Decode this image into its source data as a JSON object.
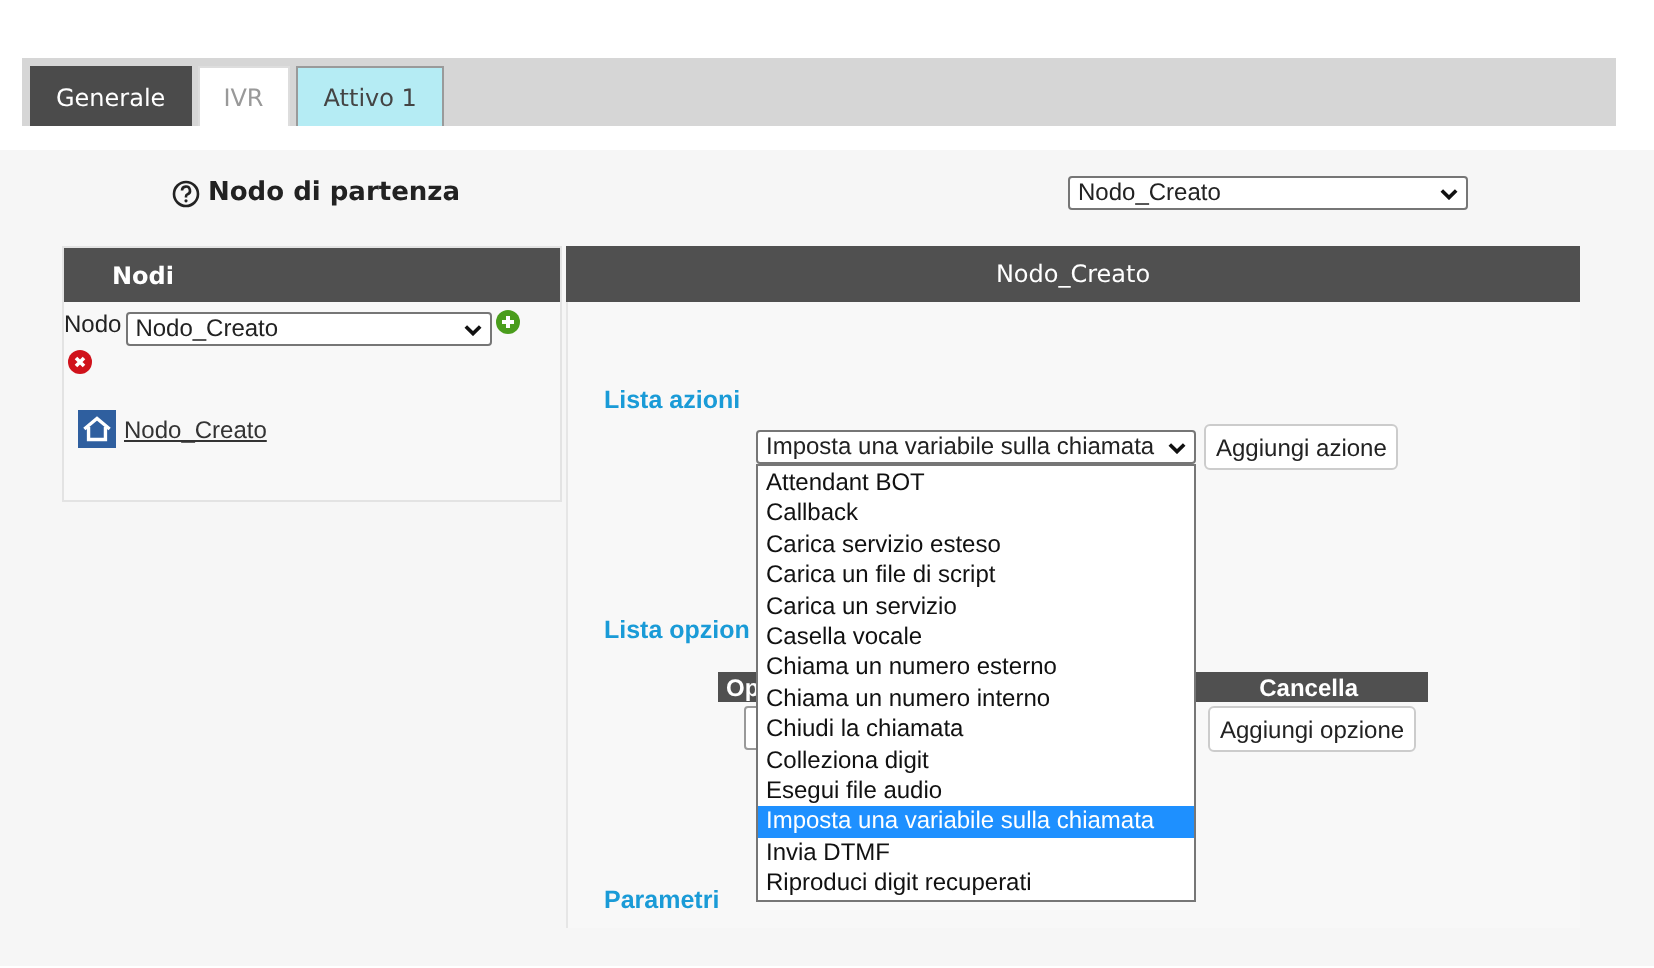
{
  "tabs": [
    {
      "label": "Generale",
      "kind": "dark",
      "selected": false
    },
    {
      "label": "IVR",
      "kind": "plain",
      "selected": true
    },
    {
      "label": "Attivo 1",
      "kind": "cyan",
      "selected": false
    }
  ],
  "start_node": {
    "label": "Nodo di partenza",
    "value": "Nodo_Creato"
  },
  "nodes_panel": {
    "title": "Nodi",
    "node_label": "Nodo",
    "node_value": "Nodo_Creato",
    "tree": [
      {
        "label": "Nodo_Creato"
      }
    ]
  },
  "detail_panel": {
    "title": "Nodo_Creato",
    "actions": {
      "title": "Lista azioni",
      "value": "Imposta una variabile sulla chiamata",
      "button": "Aggiungi azione",
      "options": [
        {
          "label": "Attendant BOT",
          "selected": false
        },
        {
          "label": "Callback",
          "selected": false
        },
        {
          "label": "Carica servizio esteso",
          "selected": false
        },
        {
          "label": "Carica un file di script",
          "selected": false
        },
        {
          "label": "Carica un servizio",
          "selected": false
        },
        {
          "label": "Casella vocale",
          "selected": false
        },
        {
          "label": "Chiama un numero esterno",
          "selected": false
        },
        {
          "label": "Chiama un numero interno",
          "selected": false
        },
        {
          "label": "Chiudi la chiamata",
          "selected": false
        },
        {
          "label": "Colleziona digit",
          "selected": false
        },
        {
          "label": "Esegui file audio",
          "selected": false
        },
        {
          "label": "Imposta una variabile sulla chiamata",
          "selected": true
        },
        {
          "label": "Invia DTMF",
          "selected": false
        },
        {
          "label": "Riproduci digit recuperati",
          "selected": false
        }
      ]
    },
    "options_list": {
      "title": "Lista opzion",
      "columns": [
        "Op",
        "Cancella"
      ],
      "button": "Aggiungi opzione"
    },
    "parameters": {
      "title": "Parametri"
    }
  }
}
